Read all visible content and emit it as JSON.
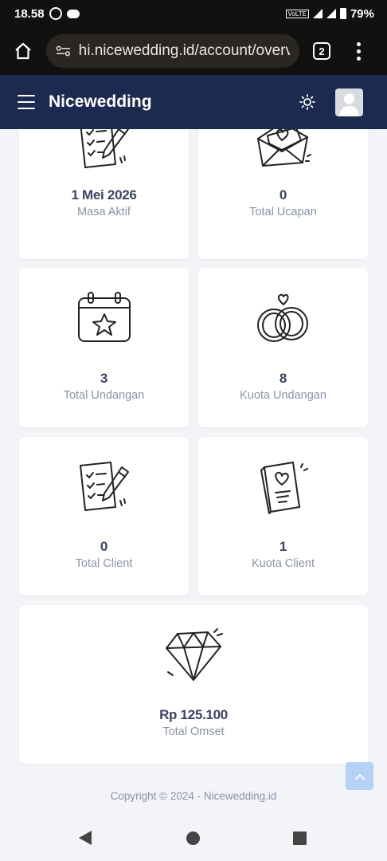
{
  "status_bar": {
    "time": "18.58",
    "volte": "VoLTE",
    "battery": "79%"
  },
  "browser": {
    "url": "hi.nicewedding.id/account/overvie",
    "tab_count": "2"
  },
  "app": {
    "brand": "Nicewedding"
  },
  "cards": [
    {
      "value": "1 Mei 2026",
      "label": "Masa Aktif",
      "icon": "checklist-pencil-icon"
    },
    {
      "value": "0",
      "label": "Total Ucapan",
      "icon": "envelope-heart-icon"
    },
    {
      "value": "3",
      "label": "Total Undangan",
      "icon": "calendar-star-icon"
    },
    {
      "value": "8",
      "label": "Kuota Undangan",
      "icon": "wedding-rings-icon"
    },
    {
      "value": "0",
      "label": "Total Client",
      "icon": "checklist-pencil-icon"
    },
    {
      "value": "1",
      "label": "Kuota Client",
      "icon": "invitation-card-icon"
    },
    {
      "value": "Rp 125.100",
      "label": "Total Omset",
      "icon": "diamond-icon"
    }
  ],
  "footer": {
    "copyright": "Copyright © 2024 - Nicewedding.id"
  }
}
